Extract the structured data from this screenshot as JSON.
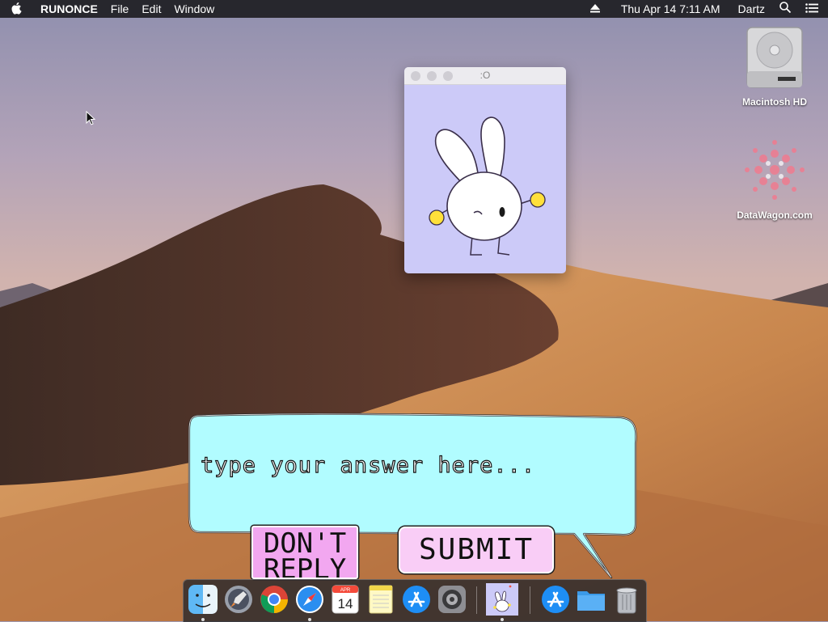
{
  "menubar": {
    "app_name": "RUNONCE",
    "menus": [
      "File",
      "Edit",
      "Window"
    ],
    "datetime": "Thu Apr 14  7:11 AM",
    "user": "Dartz"
  },
  "desktop_icons": [
    {
      "label": "Macintosh HD",
      "icon": "hard-drive-icon"
    },
    {
      "label": "DataWagon.com",
      "icon": "datawagon-logo-icon"
    }
  ],
  "mini_window": {
    "title": ":O",
    "content": "bunny-illustration"
  },
  "answer_box": {
    "placeholder": "type your answer here...",
    "value": ""
  },
  "buttons": {
    "dont_reply": "DON'T REPLY",
    "submit": "SUBMIT"
  },
  "dock": {
    "calendar_month": "APR",
    "calendar_day": "14",
    "items": [
      "finder-icon",
      "launchpad-icon",
      "chrome-icon",
      "safari-icon",
      "calendar-icon",
      "notes-icon",
      "app-store-icon",
      "system-preferences-icon",
      "bunny-app-icon",
      "app-store-downloads-icon",
      "folder-icon",
      "trash-icon"
    ]
  },
  "colors": {
    "bubble_fill": "#b1fcff",
    "window_bg": "#cccaf8",
    "dont_reply_bg": "#f2a7f0",
    "submit_bg": "#f9cdf6",
    "bunny_hands": "#ffe03a"
  }
}
